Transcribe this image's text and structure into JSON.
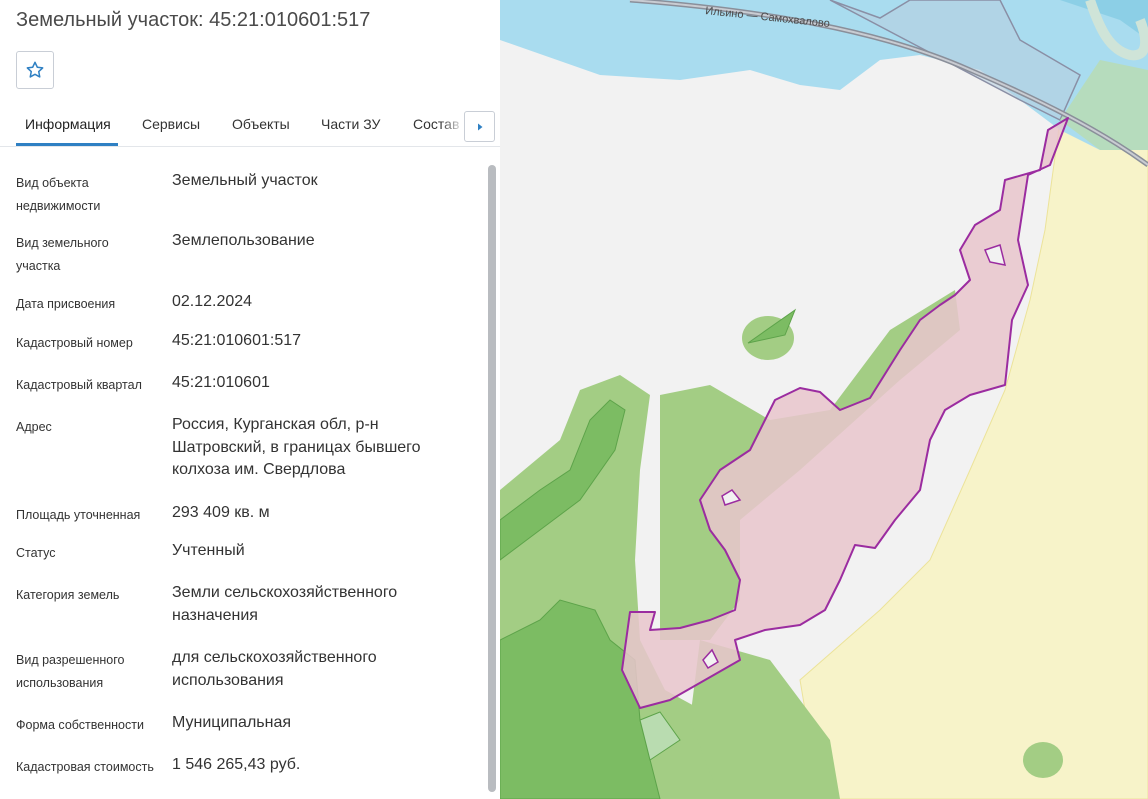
{
  "title": "Земельный участок: 45:21:010601:517",
  "favorite": {
    "icon": "star-icon"
  },
  "tabs": [
    {
      "label": "Информация",
      "active": true
    },
    {
      "label": "Сервисы"
    },
    {
      "label": "Объекты"
    },
    {
      "label": "Части ЗУ"
    },
    {
      "label": "Состав"
    }
  ],
  "tab_scroll": {
    "icon": "chevron-right-icon"
  },
  "fields": [
    {
      "label": "Вид объекта недвижимости",
      "value": "Земельный участок"
    },
    {
      "label": "Вид земельного участка",
      "value": "Землепользование"
    },
    {
      "label": "Дата присвоения",
      "value": "02.12.2024"
    },
    {
      "label": "Кадастровый номер",
      "value": "45:21:010601:517"
    },
    {
      "label": "Кадастровый квартал",
      "value": "45:21:010601"
    },
    {
      "label": "Адрес",
      "value": "Россия, Курганская обл, р-н Шатровский, в границах бывшего колхоза им. Свердлова"
    },
    {
      "label": "Площадь уточненная",
      "value": "293 409 кв. м"
    },
    {
      "label": "Статус",
      "value": "Учтенный"
    },
    {
      "label": "Категория земель",
      "value": "Земли сельскохозяйственного назначения"
    },
    {
      "label": "Вид разрешенного использования",
      "value": "для сельскохозяйственного использования"
    },
    {
      "label": "Форма собственности",
      "value": "Муниципальная"
    },
    {
      "label": "Кадастровая стоимость",
      "value": "1 546 265,43 руб."
    }
  ],
  "map": {
    "road_label": "Ильино — Самохвалово",
    "colors": {
      "water": "#a9dcef",
      "forest": "#a3cd84",
      "forest_dark": "#7cbc63",
      "agri": "#f7f3c9",
      "parcel_fill": "#e9c6cc",
      "parcel_stroke": "#9b2ca0",
      "background": "#f2f2f2"
    }
  },
  "colors": {
    "accent": "#2f80c3"
  }
}
